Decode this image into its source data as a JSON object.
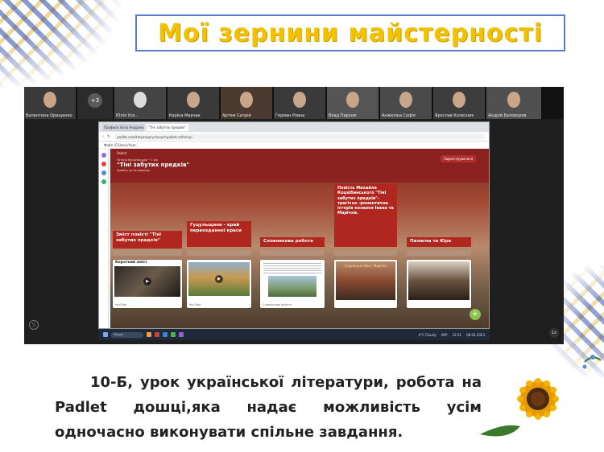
{
  "slide": {
    "title": "Мої зернини майстерності",
    "caption": "10-Б, урок української літератури, робота на Padlet дошці,яка надає можливість усім одночасно виконувати спільне завдання."
  },
  "meeting": {
    "participants": [
      {
        "name": "Валентина Орищенко",
        "type": "video"
      },
      {
        "name": "+3",
        "type": "avatar"
      },
      {
        "name": "Юлія Усе...",
        "type": "video"
      },
      {
        "name": "Каріна Марчак",
        "type": "video"
      },
      {
        "name": "Артем Сапрій",
        "type": "video"
      },
      {
        "name": "Герман Ровна",
        "type": "video"
      },
      {
        "name": "Влад Пархом",
        "type": "video"
      },
      {
        "name": "Анжеліка Софія",
        "type": "video"
      },
      {
        "name": "Ярослав Колесник",
        "type": "video"
      },
      {
        "name": "Андрій Беловоров",
        "type": "video"
      }
    ]
  },
  "browser": {
    "tabs": [
      "Профиль Бєла Андронович",
      "\"Тіні забутих предків\""
    ],
    "url": "padlet.com/tetyanapryvtovychpadlet.ro/fachy/...",
    "bookmark": "Файл (C/Users/User...",
    "padlet": {
      "logo": "Padlet",
      "author": "Тетяна Кочкурецька • 1 рік",
      "title": "\"Тіні забутих предків\"",
      "subtitle": "Зробіть це за хвилину",
      "signup_button": "Зареєструватися",
      "columns": [
        "Зміст повісті \"Тіні забутих предків\"",
        "Гуцульщина - край переозданної краси",
        "Словникова робота",
        "Повість Михайла Коцюбинського \"Тіні забутих предків\"- трагічно -романтична історія кохання Івана та Марічки.",
        "Палагна та Юра"
      ],
      "cards": [
        {
          "title": "Короткий зміст",
          "footer": "YouTube"
        },
        {
          "title": "",
          "footer": "YouTube"
        },
        {
          "title": "",
          "footer": "Словникова робота"
        },
        {
          "title": "Гуцульські Іван і Марічка",
          "footer": ""
        },
        {
          "title": "",
          "footer": ""
        }
      ]
    }
  },
  "taskbar": {
    "search": "Пошук",
    "weather": "4°C Cloudy",
    "lang": "УКР",
    "time": "12:21",
    "date": "08.02.2023"
  },
  "colors": {
    "title": "#f2c200",
    "title_border": "#5b7bd0",
    "padlet_header": "#b0271f"
  }
}
